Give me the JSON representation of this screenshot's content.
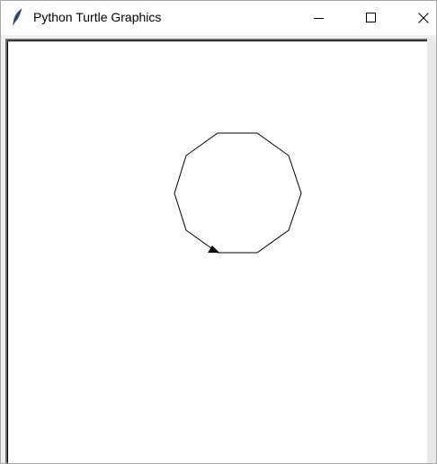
{
  "window": {
    "title": "Python Turtle Graphics",
    "controls": {
      "minimize": "minimize",
      "maximize": "maximize",
      "close": "close"
    }
  },
  "canvas": {
    "background": "#ffffff",
    "pen_color": "#000000",
    "shape": "decagon",
    "turtle_shape": "classic arrow"
  },
  "icons": {
    "app": "feather-icon",
    "minimize": "minimize-icon",
    "maximize": "maximize-icon",
    "close": "close-icon"
  }
}
